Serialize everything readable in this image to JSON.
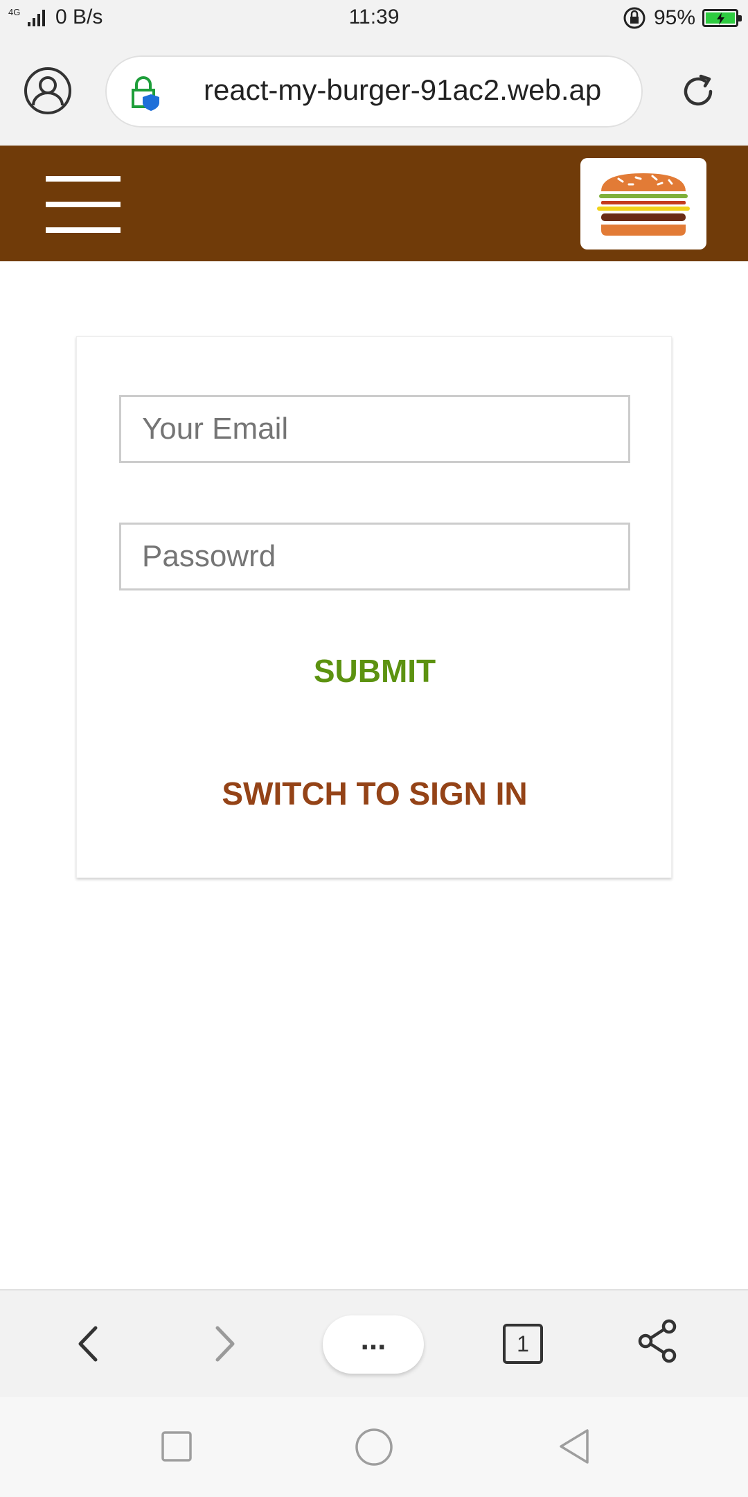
{
  "status_bar": {
    "network": "4G",
    "speed": "0 B/s",
    "time": "11:39",
    "battery": "95%"
  },
  "browser": {
    "url": "react-my-burger-91ac2.web.ap"
  },
  "toolbar": {
    "brand_color": "#703b09"
  },
  "form": {
    "email_placeholder": "Your Email",
    "password_placeholder": "Passowrd",
    "submit_label": "SUBMIT",
    "switch_label": "SWITCH TO SIGN IN",
    "submit_color": "#5c9210",
    "switch_color": "#944317"
  },
  "bottom_nav": {
    "more_label": "...",
    "tab_count": "1"
  },
  "icons": [
    "user-profile-icon",
    "lock-shield-icon",
    "reload-icon",
    "menu-icon",
    "burger-logo-icon",
    "back-icon",
    "forward-icon",
    "more-icon",
    "tabs-icon",
    "share-icon",
    "recent-apps-icon",
    "home-icon",
    "system-back-icon"
  ]
}
